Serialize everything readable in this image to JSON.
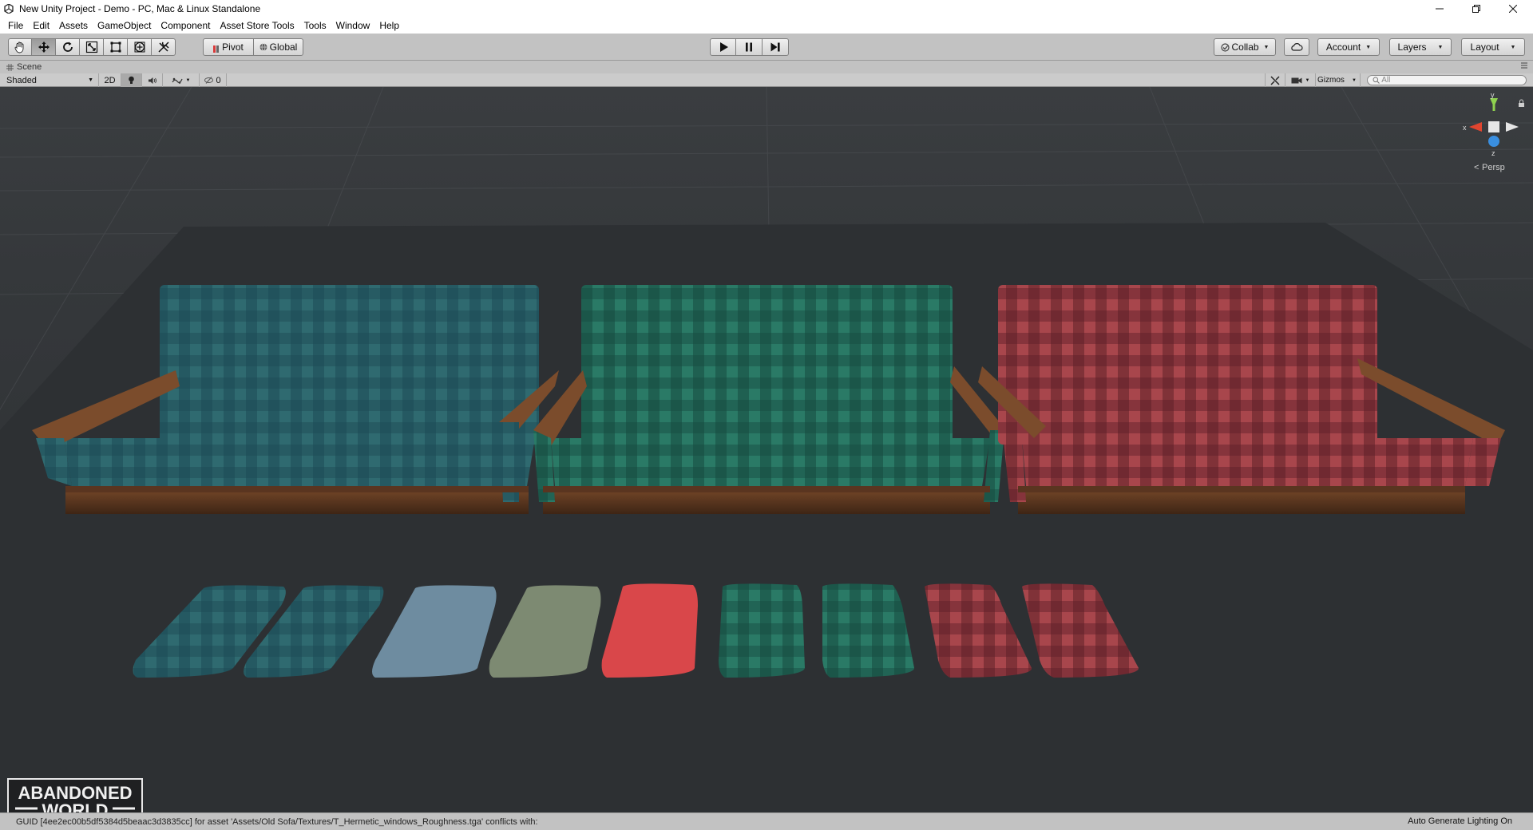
{
  "window": {
    "title": "New Unity Project - Demo - PC, Mac & Linux Standalone",
    "controls": [
      "minimize-icon",
      "restore-icon",
      "close-icon"
    ]
  },
  "menu": {
    "items": [
      "File",
      "Edit",
      "Assets",
      "GameObject",
      "Component",
      "Asset Store Tools",
      "Tools",
      "Window",
      "Help"
    ]
  },
  "toolbar": {
    "transform_tools": [
      "hand-icon",
      "move-icon",
      "rotate-icon",
      "scale-icon",
      "rect-tool-icon",
      "transform-tool-icon",
      "custom-tool-icon"
    ],
    "pivot_label": "Pivot",
    "global_label": "Global",
    "play_controls": [
      "play-icon",
      "pause-icon",
      "step-icon"
    ],
    "collab_label": "Collab",
    "account_label": "Account",
    "layers_label": "Layers",
    "layout_label": "Layout"
  },
  "scene_tab": {
    "label": "Scene"
  },
  "scene_toolbar": {
    "shading_mode": "Shaded",
    "mode_2d": "2D",
    "effects_count": "0",
    "gizmos_label": "Gizmos",
    "search_placeholder": "All"
  },
  "viewport": {
    "projection_label": "Persp",
    "axis_labels": {
      "y": "y",
      "x": "x",
      "z": "z"
    },
    "sofas": [
      {
        "name": "sofa-teal-blue",
        "fabric_color": "#2f6a70"
      },
      {
        "name": "sofa-green",
        "fabric_color": "#2a7a66"
      },
      {
        "name": "sofa-red",
        "fabric_color": "#9a3d44"
      }
    ],
    "cushions": [
      {
        "fabric_color": "#3a6a72"
      },
      {
        "fabric_color": "#3a6a72"
      },
      {
        "fabric_color": "#6e8ca0"
      },
      {
        "fabric_color": "#7d8a72"
      },
      {
        "fabric_color": "#d9474a"
      },
      {
        "fabric_color": "#2e7a66"
      },
      {
        "fabric_color": "#2d7062"
      },
      {
        "fabric_color": "#a63b45"
      },
      {
        "fabric_color": "#9a3742"
      }
    ]
  },
  "status": {
    "message": "GUID [4ee2ec00b5df5384d5beaac3d3835cc] for asset 'Assets/Old Sofa/Textures/T_Hermetic_windows_Roughness.tga' conflicts with:",
    "right_text": "Auto Generate Lighting On"
  },
  "watermark": {
    "line1": "ABANDONED",
    "line2": "WORLD"
  }
}
